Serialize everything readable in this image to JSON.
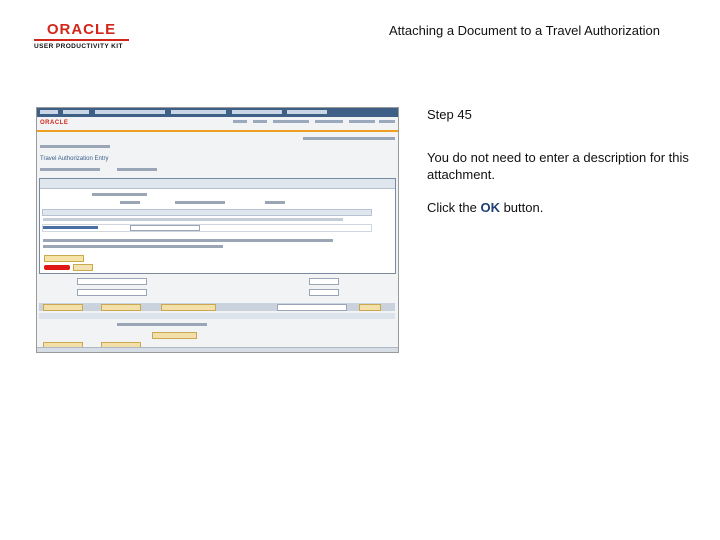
{
  "header": {
    "logo_word": "ORACLE",
    "logo_sub": "USER PRODUCTIVITY KIT",
    "title": "Attaching a Document to a Travel Authorization"
  },
  "instructions": {
    "step": "Step 45",
    "text": "You do not need to enter a description for this attachment.",
    "action_prefix": "Click the ",
    "action_target": "OK",
    "action_suffix": " button."
  },
  "screenshot": {
    "brand": "ORACLE",
    "section_label": "Travel Authorization Entry"
  },
  "colors": {
    "oracle_red": "#d3261b",
    "ok_button": "#e01717",
    "ps_nav_blue": "#3e5f86",
    "target_text": "#1f3f74"
  }
}
